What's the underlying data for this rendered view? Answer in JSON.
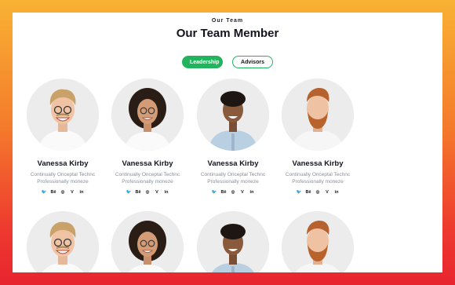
{
  "section": {
    "eyebrow": "Our Team",
    "title": "Our Team Member"
  },
  "tabs": [
    {
      "label": "Leadership",
      "active": true
    },
    {
      "label": "Advisors",
      "active": false
    }
  ],
  "members": [
    {
      "name": "Vanessa Kirby",
      "line1": "Continually Onceptal Technc",
      "line2": "Professionally moneze"
    },
    {
      "name": "Vanessa Kirby",
      "line1": "Continually Onceptal Technc",
      "line2": "Professionally moneze"
    },
    {
      "name": "Vanessa Kirby",
      "line1": "Continually Onceptal Technc",
      "line2": "Professionally moneze"
    },
    {
      "name": "Vanessa Kirby",
      "line1": "Continually Onceptal Technc",
      "line2": "Professionally moneze"
    }
  ],
  "socials": [
    {
      "icon": "twitter-icon",
      "glyph": "🐦"
    },
    {
      "icon": "behance-icon",
      "glyph": "Bē"
    },
    {
      "icon": "instagram-icon",
      "glyph": "◎"
    },
    {
      "icon": "vimeo-icon",
      "glyph": "V"
    },
    {
      "icon": "linkedin-icon",
      "glyph": "in"
    }
  ],
  "colors": {
    "accent": "#22b45c",
    "gradient_top": "#f9b233",
    "gradient_bottom": "#e8242f"
  }
}
